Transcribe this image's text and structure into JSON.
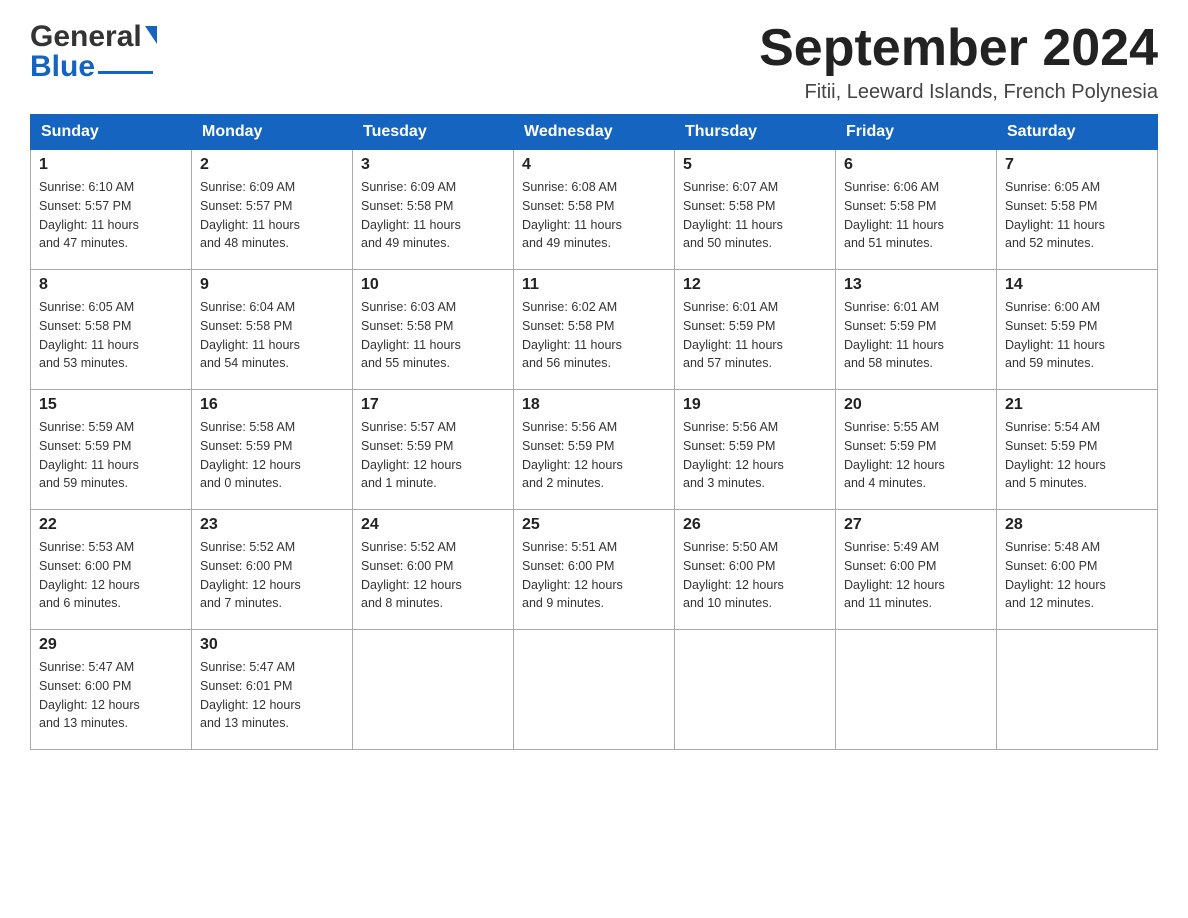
{
  "header": {
    "logo_general": "General",
    "logo_blue": "Blue",
    "month_title": "September 2024",
    "location": "Fitii, Leeward Islands, French Polynesia"
  },
  "days_of_week": [
    "Sunday",
    "Monday",
    "Tuesday",
    "Wednesday",
    "Thursday",
    "Friday",
    "Saturday"
  ],
  "weeks": [
    [
      {
        "day": "1",
        "sunrise": "6:10 AM",
        "sunset": "5:57 PM",
        "daylight": "11 hours and 47 minutes."
      },
      {
        "day": "2",
        "sunrise": "6:09 AM",
        "sunset": "5:57 PM",
        "daylight": "11 hours and 48 minutes."
      },
      {
        "day": "3",
        "sunrise": "6:09 AM",
        "sunset": "5:58 PM",
        "daylight": "11 hours and 49 minutes."
      },
      {
        "day": "4",
        "sunrise": "6:08 AM",
        "sunset": "5:58 PM",
        "daylight": "11 hours and 49 minutes."
      },
      {
        "day": "5",
        "sunrise": "6:07 AM",
        "sunset": "5:58 PM",
        "daylight": "11 hours and 50 minutes."
      },
      {
        "day": "6",
        "sunrise": "6:06 AM",
        "sunset": "5:58 PM",
        "daylight": "11 hours and 51 minutes."
      },
      {
        "day": "7",
        "sunrise": "6:05 AM",
        "sunset": "5:58 PM",
        "daylight": "11 hours and 52 minutes."
      }
    ],
    [
      {
        "day": "8",
        "sunrise": "6:05 AM",
        "sunset": "5:58 PM",
        "daylight": "11 hours and 53 minutes."
      },
      {
        "day": "9",
        "sunrise": "6:04 AM",
        "sunset": "5:58 PM",
        "daylight": "11 hours and 54 minutes."
      },
      {
        "day": "10",
        "sunrise": "6:03 AM",
        "sunset": "5:58 PM",
        "daylight": "11 hours and 55 minutes."
      },
      {
        "day": "11",
        "sunrise": "6:02 AM",
        "sunset": "5:58 PM",
        "daylight": "11 hours and 56 minutes."
      },
      {
        "day": "12",
        "sunrise": "6:01 AM",
        "sunset": "5:59 PM",
        "daylight": "11 hours and 57 minutes."
      },
      {
        "day": "13",
        "sunrise": "6:01 AM",
        "sunset": "5:59 PM",
        "daylight": "11 hours and 58 minutes."
      },
      {
        "day": "14",
        "sunrise": "6:00 AM",
        "sunset": "5:59 PM",
        "daylight": "11 hours and 59 minutes."
      }
    ],
    [
      {
        "day": "15",
        "sunrise": "5:59 AM",
        "sunset": "5:59 PM",
        "daylight": "11 hours and 59 minutes."
      },
      {
        "day": "16",
        "sunrise": "5:58 AM",
        "sunset": "5:59 PM",
        "daylight": "12 hours and 0 minutes."
      },
      {
        "day": "17",
        "sunrise": "5:57 AM",
        "sunset": "5:59 PM",
        "daylight": "12 hours and 1 minute."
      },
      {
        "day": "18",
        "sunrise": "5:56 AM",
        "sunset": "5:59 PM",
        "daylight": "12 hours and 2 minutes."
      },
      {
        "day": "19",
        "sunrise": "5:56 AM",
        "sunset": "5:59 PM",
        "daylight": "12 hours and 3 minutes."
      },
      {
        "day": "20",
        "sunrise": "5:55 AM",
        "sunset": "5:59 PM",
        "daylight": "12 hours and 4 minutes."
      },
      {
        "day": "21",
        "sunrise": "5:54 AM",
        "sunset": "5:59 PM",
        "daylight": "12 hours and 5 minutes."
      }
    ],
    [
      {
        "day": "22",
        "sunrise": "5:53 AM",
        "sunset": "6:00 PM",
        "daylight": "12 hours and 6 minutes."
      },
      {
        "day": "23",
        "sunrise": "5:52 AM",
        "sunset": "6:00 PM",
        "daylight": "12 hours and 7 minutes."
      },
      {
        "day": "24",
        "sunrise": "5:52 AM",
        "sunset": "6:00 PM",
        "daylight": "12 hours and 8 minutes."
      },
      {
        "day": "25",
        "sunrise": "5:51 AM",
        "sunset": "6:00 PM",
        "daylight": "12 hours and 9 minutes."
      },
      {
        "day": "26",
        "sunrise": "5:50 AM",
        "sunset": "6:00 PM",
        "daylight": "12 hours and 10 minutes."
      },
      {
        "day": "27",
        "sunrise": "5:49 AM",
        "sunset": "6:00 PM",
        "daylight": "12 hours and 11 minutes."
      },
      {
        "day": "28",
        "sunrise": "5:48 AM",
        "sunset": "6:00 PM",
        "daylight": "12 hours and 12 minutes."
      }
    ],
    [
      {
        "day": "29",
        "sunrise": "5:47 AM",
        "sunset": "6:00 PM",
        "daylight": "12 hours and 13 minutes."
      },
      {
        "day": "30",
        "sunrise": "5:47 AM",
        "sunset": "6:01 PM",
        "daylight": "12 hours and 13 minutes."
      },
      null,
      null,
      null,
      null,
      null
    ]
  ],
  "labels": {
    "sunrise": "Sunrise:",
    "sunset": "Sunset:",
    "daylight": "Daylight:"
  }
}
